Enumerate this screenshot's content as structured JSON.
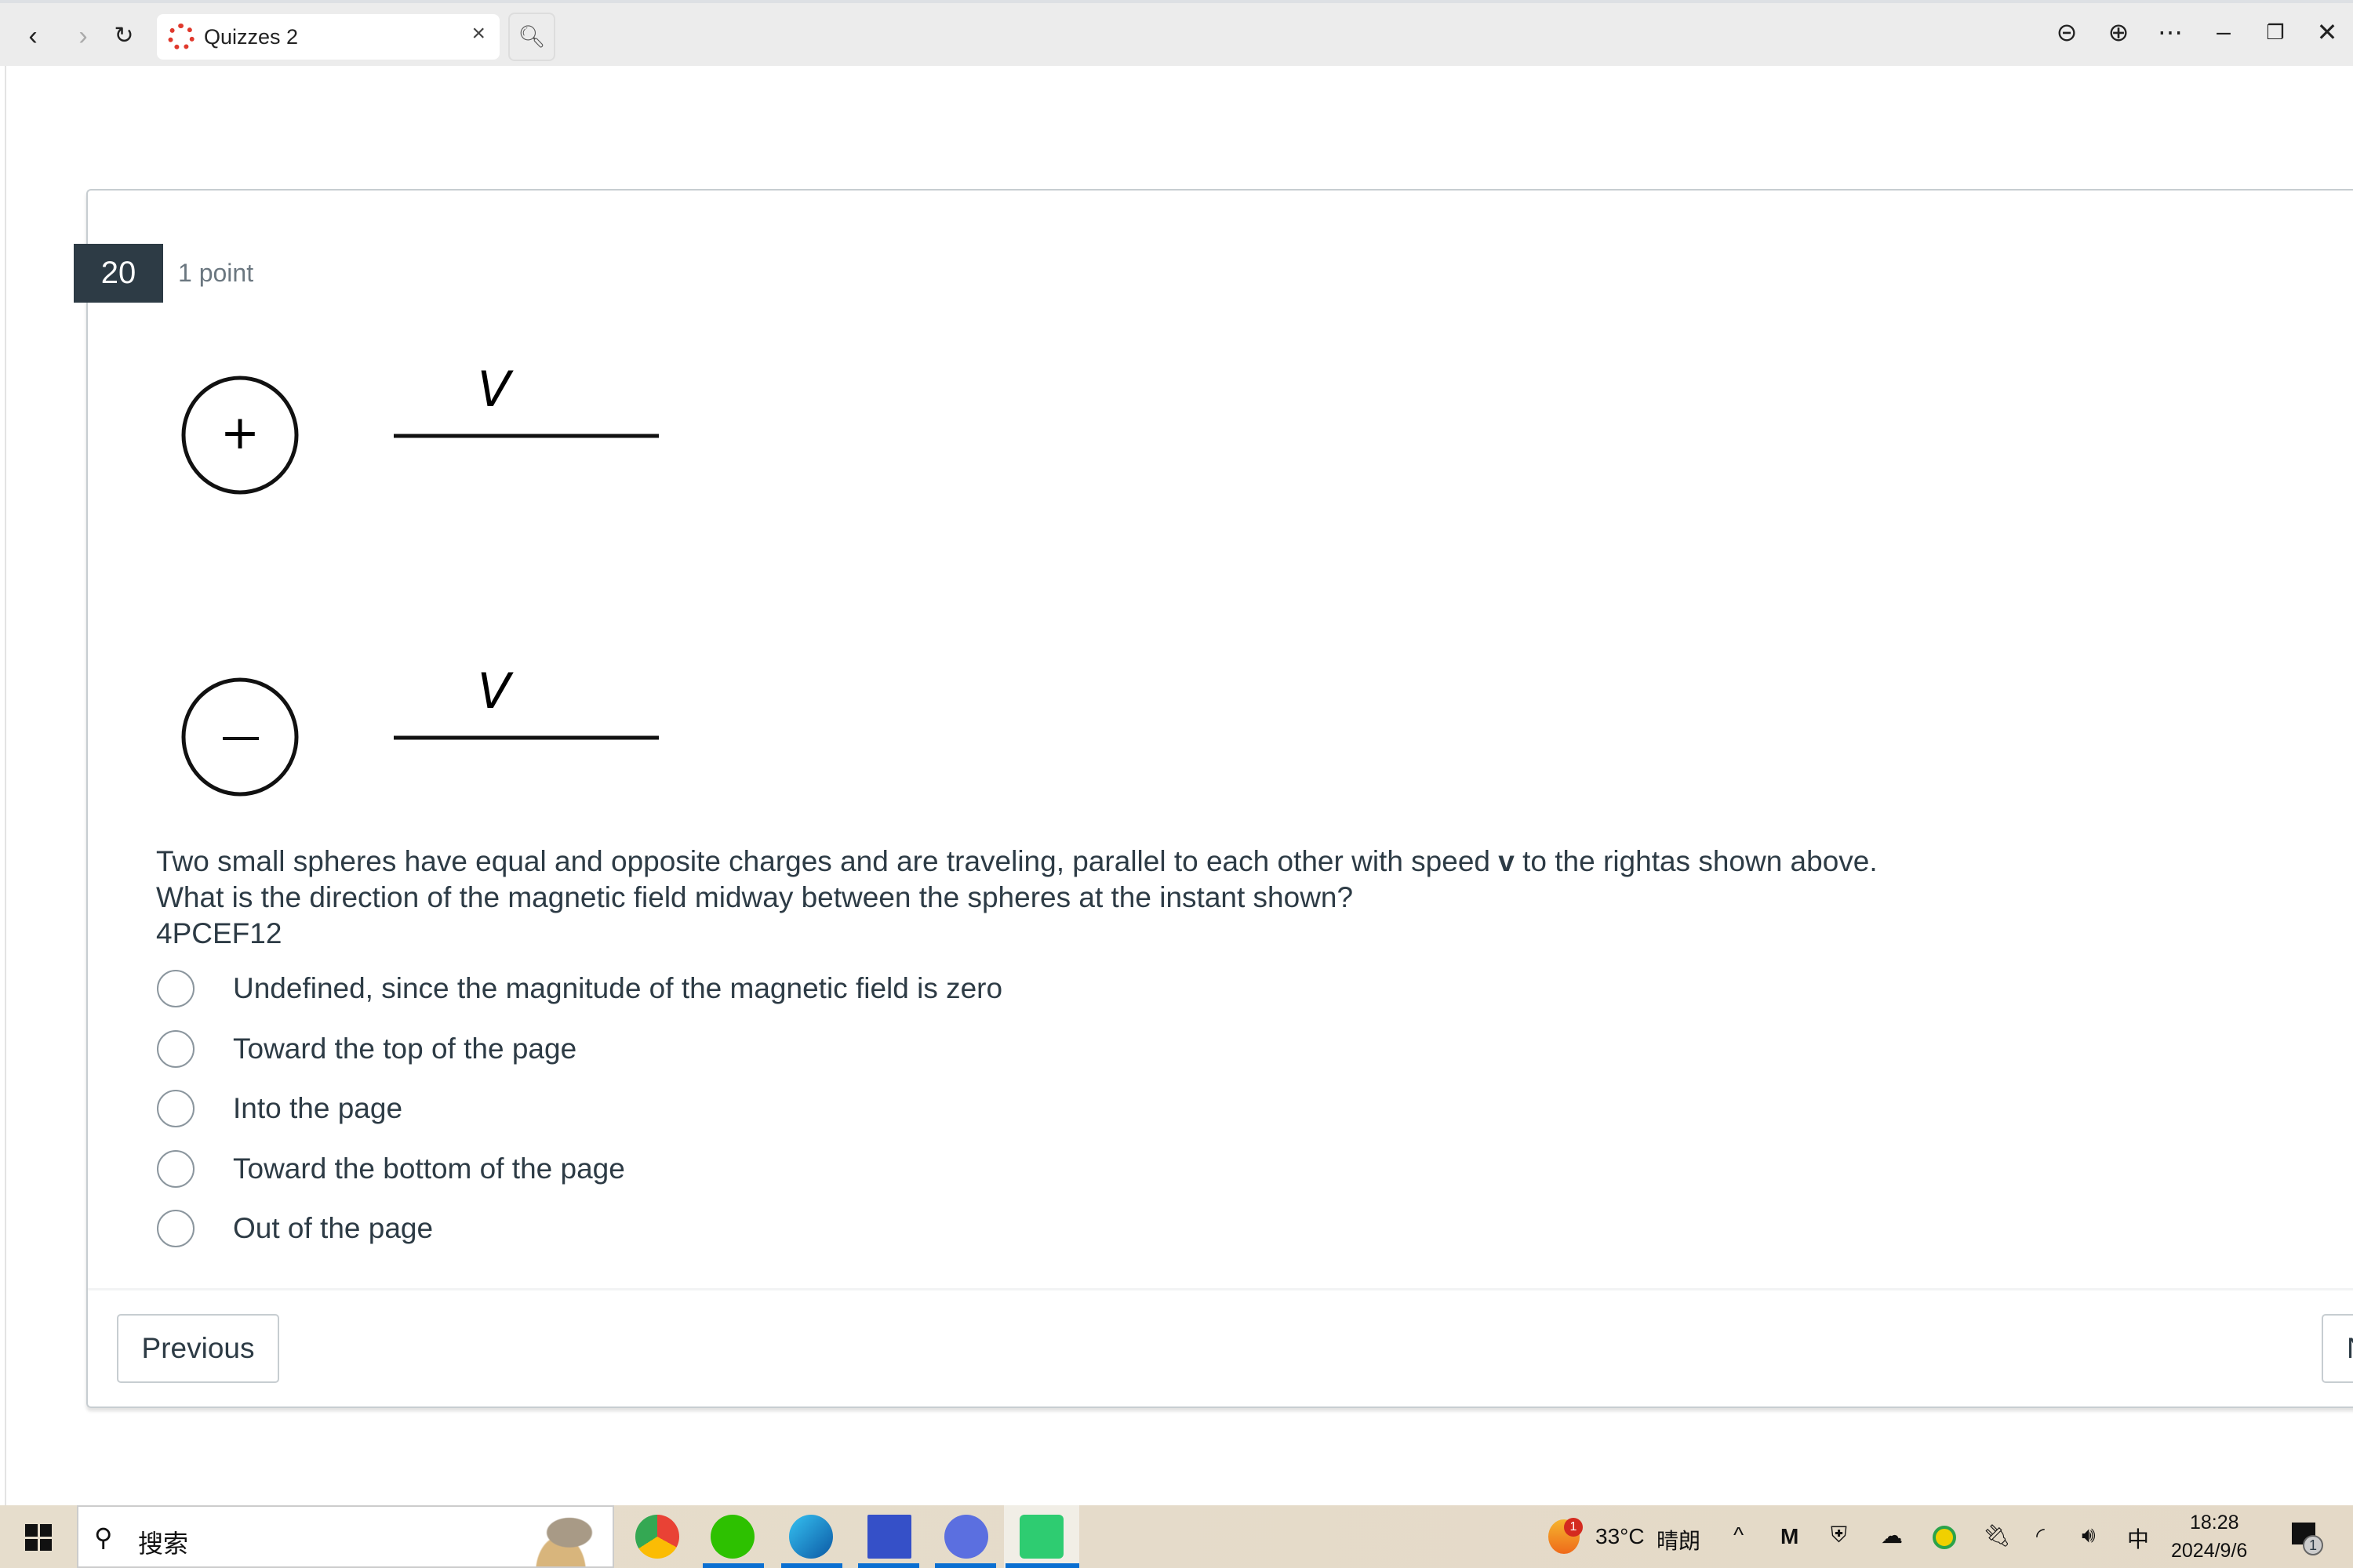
{
  "browser": {
    "tab_title": "Quizzes 2",
    "tab_icon": "canvas-logo-icon",
    "accent": "#e0392d"
  },
  "question": {
    "number": "20",
    "points": "1 point",
    "diagram": {
      "top_charge": "+",
      "bottom_charge": "−",
      "velocity_label": "V"
    },
    "text_line1_a": "Two small spheres have equal and opposite charges and are traveling, parallel to each other with speed ",
    "text_line1_v": "v",
    "text_line1_b": " to the rightas shown above.",
    "text_line2": "What is the direction of the magnetic field midway between the spheres at the instant shown?",
    "code": "4PCEF12",
    "options": [
      "Undefined, since the magnitude of the magnetic field is zero",
      "Toward the top of the page",
      "Into the page",
      "Toward the bottom of the page",
      "Out of the page"
    ]
  },
  "nav": {
    "previous": "Previous",
    "next": "N"
  },
  "taskbar": {
    "search_placeholder": "搜索",
    "weather_temp": "33°C",
    "weather_desc": "晴朗",
    "weather_badge": "1",
    "ime": "中",
    "time": "18:28",
    "date": "2024/9/6",
    "notification_count": "1"
  }
}
